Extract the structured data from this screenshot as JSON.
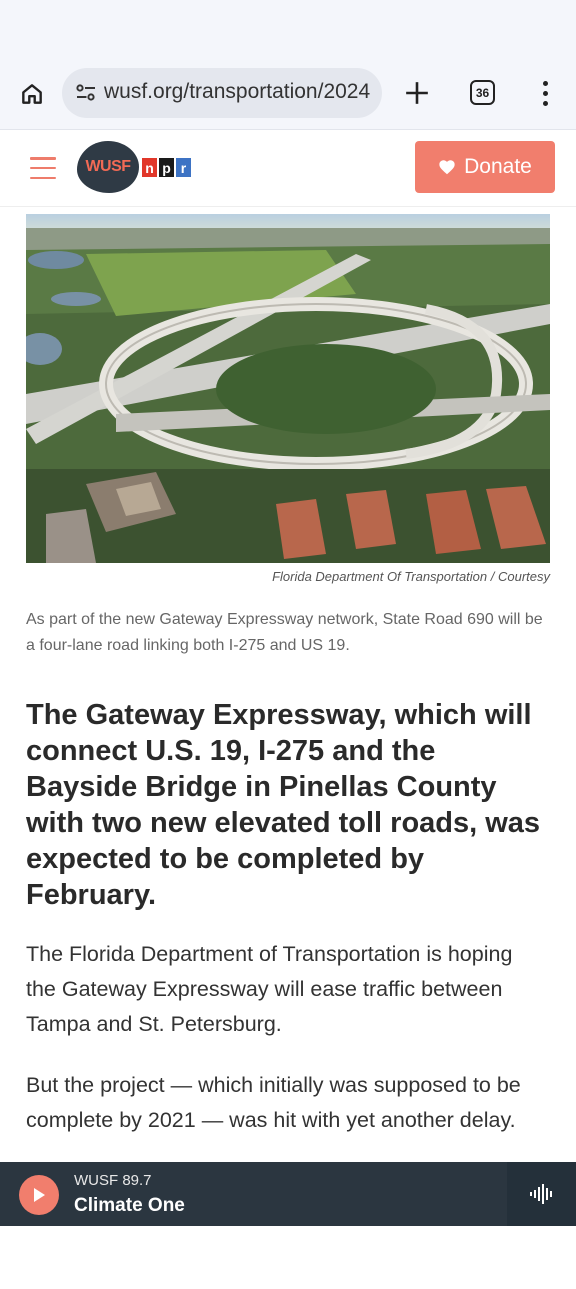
{
  "browser": {
    "url": "wusf.org/transportation/2024",
    "tab_count": "36"
  },
  "header": {
    "logo_text": "WUSF",
    "npr_letters": [
      "n",
      "p",
      "r"
    ],
    "donate_label": "Donate",
    "accent_color": "#f17e6d"
  },
  "article": {
    "image_credit": "Florida Department Of Transportation  /  Courtesy",
    "image_caption": "As part of the new Gateway Expressway network, State Road 690 will be a four-lane road linking both I-275 and US 19.",
    "headline": "The Gateway Expressway, which will connect U.S. 19, I-275 and the Bayside Bridge in Pinellas County with two new elevated toll roads, was expected to be completed by February.",
    "paragraphs": [
      "The Florida Department of Transportation is hoping the Gateway Expressway will ease traffic between Tampa and St. Petersburg.",
      "But the project — which initially was supposed to be complete by 2021 — was hit with yet another delay."
    ]
  },
  "player": {
    "station": "WUSF 89.7",
    "program": "Climate One"
  }
}
